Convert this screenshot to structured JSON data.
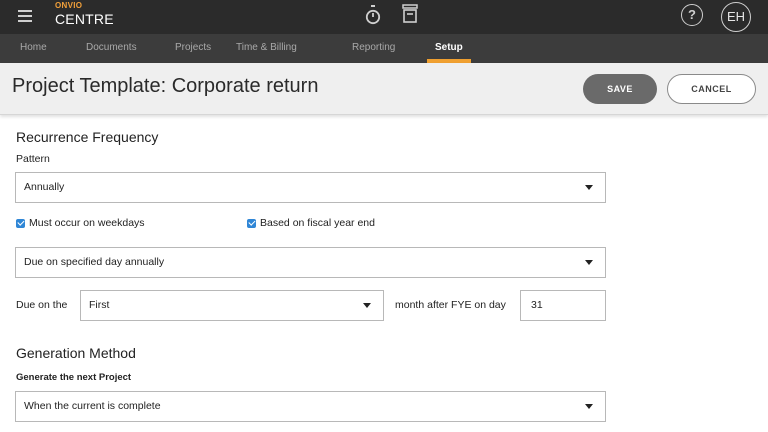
{
  "app": {
    "brand_top": "ONVIO",
    "brand_bottom": "CENTRE",
    "user_initials": "EH",
    "help_glyph": "?"
  },
  "topbar_icons": [
    "menu-icon",
    "stopwatch-icon",
    "archive-icon",
    "help-icon"
  ],
  "nav": {
    "items": [
      {
        "label": "Home"
      },
      {
        "label": "Documents"
      },
      {
        "label": "Projects"
      },
      {
        "label": "Time & Billing"
      },
      {
        "label": "Reporting"
      },
      {
        "label": "Setup",
        "active": true
      }
    ]
  },
  "header": {
    "title": "Project Template: Corporate return",
    "save_label": "SAVE",
    "cancel_label": "CANCEL"
  },
  "recurrence": {
    "title": "Recurrence Frequency",
    "pattern_label": "Pattern",
    "pattern_value": "Annually",
    "weekdays_label": "Must occur on weekdays",
    "weekdays_checked": true,
    "fiscal_label": "Based on fiscal year end",
    "fiscal_checked": true,
    "due_type_value": "Due on specified day annually",
    "due_on_label": "Due on the",
    "due_on_value": "First",
    "month_after_label": "month after FYE on day",
    "day_value": "31"
  },
  "generation": {
    "title": "Generation Method",
    "next_label": "Generate the next Project",
    "next_value": "When the current is complete"
  },
  "colors": {
    "topbar": "#2b2b2b",
    "nav": "#3c3c3c",
    "accent": "#f0a030",
    "checkbox": "#2f86d6",
    "save_button": "#6a6a6a"
  }
}
